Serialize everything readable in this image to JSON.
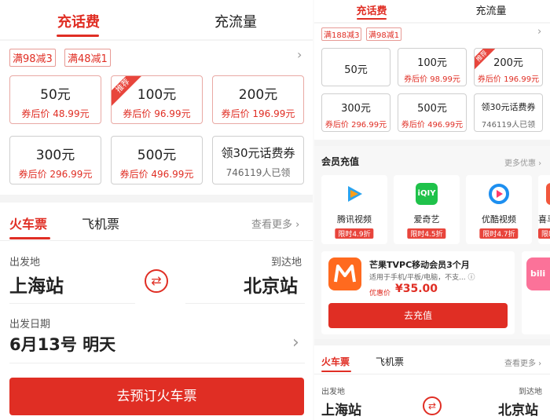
{
  "left": {
    "tabs": [
      "充话费",
      "充流量"
    ],
    "promos": [
      "满98减3",
      "满48减1"
    ],
    "cards": [
      {
        "amount": "50元",
        "sub": "券后价 48.99元"
      },
      {
        "amount": "100元",
        "sub": "券后价 96.99元",
        "badge": "推荐"
      },
      {
        "amount": "200元",
        "sub": "券后价 196.99元"
      },
      {
        "amount": "300元",
        "sub": "券后价 296.99元"
      },
      {
        "amount": "500元",
        "sub": "券后价 496.99元"
      },
      {
        "amount": "领30元话费券",
        "sub": "746119人已领"
      }
    ],
    "ticket": {
      "tabs": [
        "火车票",
        "飞机票"
      ],
      "more": "查看更多",
      "from_label": "出发地",
      "to_label": "到达地",
      "from": "上海站",
      "to": "北京站",
      "date_label": "出发日期",
      "date": "6月13号 明天",
      "book": "去预订火车票"
    }
  },
  "right": {
    "tabs": [
      "充话费",
      "充流量"
    ],
    "promos": [
      "满188减3",
      "满98减1"
    ],
    "cards": [
      {
        "amount": "50元"
      },
      {
        "amount": "100元",
        "sub": "券后价 98.99元"
      },
      {
        "amount": "200元",
        "sub": "券后价 196.99元",
        "badge": "推荐"
      },
      {
        "amount": "300元",
        "sub": "券后价 296.99元"
      },
      {
        "amount": "500元",
        "sub": "券后价 496.99元"
      },
      {
        "amount": "领30元话费券",
        "sub": "746119人已领"
      }
    ],
    "vip": {
      "title": "会员充值",
      "more": "更多优惠",
      "apps": [
        {
          "name": "腾讯视频",
          "discount": "限时4.9折",
          "icon": "tencent-video-icon",
          "color": "#2aa3ef"
        },
        {
          "name": "爱奇艺",
          "discount": "限时4.5折",
          "icon": "iqiyi-icon",
          "color": "#1fc24a"
        },
        {
          "name": "优酷视频",
          "discount": "限时4.7折",
          "icon": "youku-icon",
          "color": "#1d8ff0"
        },
        {
          "name": "喜马拉雅",
          "discount": "限时",
          "icon": "ximalaya-icon",
          "color": "#f2573c"
        }
      ],
      "offer": {
        "title": "芒果TVPC移动会员3个月",
        "desc": "适用于手机/平板/电脑，不支...",
        "price_label": "优惠价",
        "price": "¥35.00",
        "button": "去充值"
      }
    },
    "ticket": {
      "tabs": [
        "火车票",
        "飞机票"
      ],
      "more": "查看更多",
      "from_label": "出发地",
      "to_label": "到达地",
      "from": "上海站",
      "to": "北京站"
    }
  },
  "colors": {
    "accent": "#e02e24",
    "iqiyi": "#1fc24a",
    "mango": "#ff6a1f",
    "bili": "#fb7299"
  }
}
